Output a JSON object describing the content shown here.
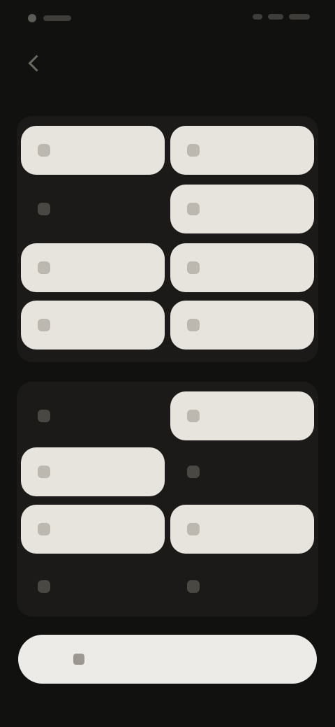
{
  "status_bar": {
    "time": "",
    "indicators": [
      "battery-icon",
      "signal-icon",
      "wifi-icon"
    ]
  },
  "header": {
    "title": "",
    "back_icon": "chevron-left-icon"
  },
  "group1": {
    "tiles": [
      {
        "label": "",
        "active": true,
        "icon": "wifi-icon"
      },
      {
        "label": "",
        "active": true,
        "icon": "bluetooth-icon"
      },
      {
        "label": "",
        "active": false,
        "icon": "mobile-data-icon"
      },
      {
        "label": "",
        "active": true,
        "icon": "flashlight-icon"
      },
      {
        "label": "",
        "active": true,
        "icon": "airplane-icon"
      },
      {
        "label": "",
        "active": true,
        "icon": "rotation-icon"
      },
      {
        "label": "",
        "active": true,
        "icon": "location-icon"
      },
      {
        "label": "",
        "active": true,
        "icon": "hotspot-icon"
      }
    ]
  },
  "group2": {
    "tiles": [
      {
        "label": "",
        "active": false,
        "icon": "dark-mode-icon"
      },
      {
        "label": "",
        "active": true,
        "icon": "battery-saver-icon"
      },
      {
        "label": "",
        "active": true,
        "icon": "do-not-disturb-icon"
      },
      {
        "label": "",
        "active": false,
        "icon": "screen-cast-icon"
      },
      {
        "label": "",
        "active": true,
        "icon": "nfc-icon"
      },
      {
        "label": "",
        "active": true,
        "icon": "screenshot-icon"
      },
      {
        "label": "",
        "active": false,
        "icon": "eye-comfort-icon"
      },
      {
        "label": "",
        "active": false,
        "icon": "qr-scan-icon"
      }
    ]
  },
  "bottom_button": {
    "label": "",
    "icon": "edit-icon"
  },
  "colors": {
    "background": "#111110",
    "group": "#1b1a18",
    "tile_active": "#e7e4de",
    "button": "#ecebe8"
  }
}
